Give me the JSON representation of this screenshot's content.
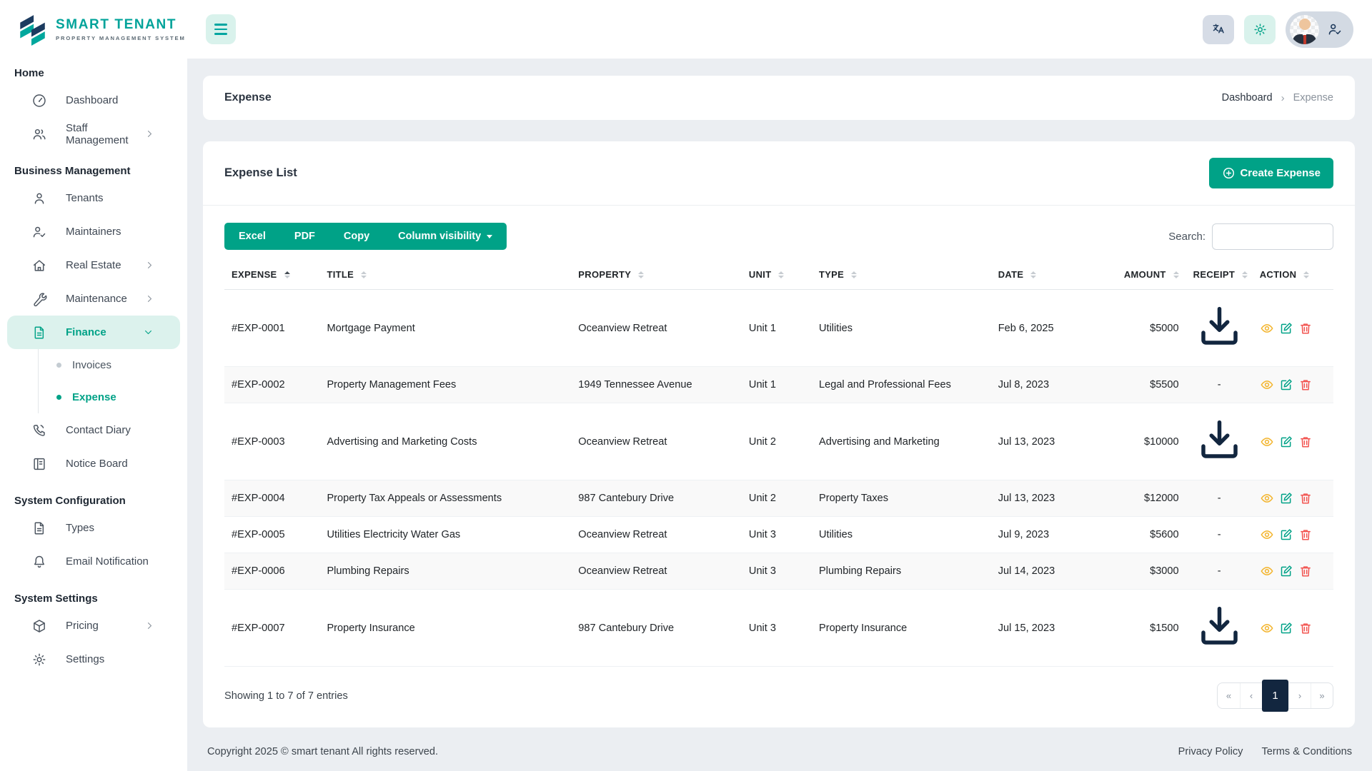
{
  "brand": {
    "name": "SMART TENANT",
    "tagline": "PROPERTY MANAGEMENT SYSTEM"
  },
  "sidebar": {
    "sections": [
      {
        "label": "Home",
        "items": [
          {
            "label": "Dashboard",
            "icon": "dashboard-icon"
          },
          {
            "label": "Staff Management",
            "icon": "staff-icon",
            "chevron": "right"
          }
        ]
      },
      {
        "label": "Business Management",
        "items": [
          {
            "label": "Tenants",
            "icon": "person-icon"
          },
          {
            "label": "Maintainers",
            "icon": "person-check-icon"
          },
          {
            "label": "Real Estate",
            "icon": "home-icon",
            "chevron": "right"
          },
          {
            "label": "Maintenance",
            "icon": "wrench-icon",
            "chevron": "right"
          },
          {
            "label": "Finance",
            "icon": "file-icon",
            "chevron": "down",
            "active": true,
            "children": [
              {
                "label": "Invoices",
                "active": false
              },
              {
                "label": "Expense",
                "active": true
              }
            ]
          },
          {
            "label": "Contact Diary",
            "icon": "phone-icon"
          },
          {
            "label": "Notice Board",
            "icon": "board-icon"
          }
        ]
      },
      {
        "label": "System Configuration",
        "items": [
          {
            "label": "Types",
            "icon": "file-icon"
          },
          {
            "label": "Email Notification",
            "icon": "bell-icon"
          }
        ]
      },
      {
        "label": "System Settings",
        "items": [
          {
            "label": "Pricing",
            "icon": "pricing-icon",
            "chevron": "right"
          },
          {
            "label": "Settings",
            "icon": "gear-icon"
          }
        ]
      }
    ]
  },
  "page": {
    "title": "Expense",
    "breadcrumb": [
      "Dashboard",
      "Expense"
    ]
  },
  "expense_list": {
    "title": "Expense List",
    "create_button": "Create Expense",
    "export_buttons": [
      "Excel",
      "PDF",
      "Copy"
    ],
    "column_visibility_button": "Column visibility",
    "search_label": "Search:",
    "search_value": ""
  },
  "table": {
    "columns": [
      "EXPENSE",
      "TITLE",
      "PROPERTY",
      "UNIT",
      "TYPE",
      "DATE",
      "AMOUNT",
      "RECEIPT",
      "ACTION"
    ],
    "sort": {
      "column": "EXPENSE",
      "direction": "asc"
    },
    "rows": [
      {
        "expense": "#EXP-0001",
        "title": "Mortgage Payment",
        "property": "Oceanview Retreat",
        "unit": "Unit 1",
        "type": "Utilities",
        "date": "Feb 6, 2025",
        "amount": "$5000",
        "receipt": "download"
      },
      {
        "expense": "#EXP-0002",
        "title": "Property Management Fees",
        "property": "1949 Tennessee Avenue",
        "unit": "Unit 1",
        "type": "Legal and Professional Fees",
        "date": "Jul 8, 2023",
        "amount": "$5500",
        "receipt": "-"
      },
      {
        "expense": "#EXP-0003",
        "title": "Advertising and Marketing Costs",
        "property": "Oceanview Retreat",
        "unit": "Unit 2",
        "type": "Advertising and Marketing",
        "date": "Jul 13, 2023",
        "amount": "$10000",
        "receipt": "download"
      },
      {
        "expense": "#EXP-0004",
        "title": "Property Tax Appeals or Assessments",
        "property": "987 Cantebury Drive",
        "unit": "Unit 2",
        "type": "Property Taxes",
        "date": "Jul 13, 2023",
        "amount": "$12000",
        "receipt": "-"
      },
      {
        "expense": "#EXP-0005",
        "title": "Utilities Electricity Water Gas",
        "property": "Oceanview Retreat",
        "unit": "Unit 3",
        "type": "Utilities",
        "date": "Jul 9, 2023",
        "amount": "$5600",
        "receipt": "-"
      },
      {
        "expense": "#EXP-0006",
        "title": "Plumbing Repairs",
        "property": "Oceanview Retreat",
        "unit": "Unit 3",
        "type": "Plumbing Repairs",
        "date": "Jul 14, 2023",
        "amount": "$3000",
        "receipt": "-"
      },
      {
        "expense": "#EXP-0007",
        "title": "Property Insurance",
        "property": "987 Cantebury Drive",
        "unit": "Unit 3",
        "type": "Property Insurance",
        "date": "Jul 15, 2023",
        "amount": "$1500",
        "receipt": "download"
      }
    ],
    "info": "Showing 1 to 7 of 7 entries",
    "pagination": {
      "first": "«",
      "prev": "‹",
      "pages": [
        "1"
      ],
      "active_page": "1",
      "next": "›",
      "last": "»"
    }
  },
  "footer": {
    "copyright": "Copyright 2025 © smart tenant All rights reserved.",
    "links": [
      "Privacy Policy",
      "Terms & Conditions"
    ]
  },
  "colors": {
    "brand_teal": "#00a287",
    "navy": "#12263f",
    "view_yellow": "#f3b42c",
    "edit_teal": "#00a287",
    "delete_red": "#f2534f",
    "active_bg": "#dcf2ed"
  }
}
